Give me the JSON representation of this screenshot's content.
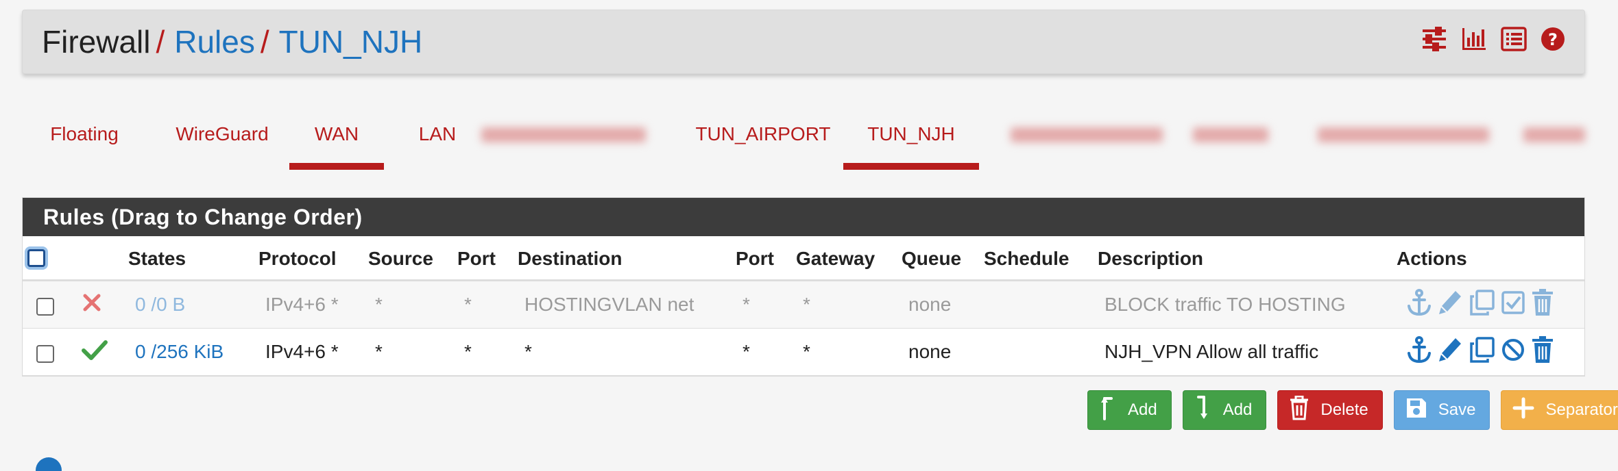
{
  "breadcrumb": {
    "home": "Firewall",
    "sep": "/",
    "rules": "Rules",
    "current": "TUN_NJH"
  },
  "header_icons": [
    "sliders-icon",
    "bar-chart-icon",
    "list-icon",
    "help-icon"
  ],
  "tabs": [
    {
      "label": "Floating",
      "active": false
    },
    {
      "label": "WireGuard",
      "active": false
    },
    {
      "label": "WAN",
      "active": true
    },
    {
      "label": "LAN",
      "active": false
    },
    {
      "label": "TUN_AIRPORT",
      "active": false
    },
    {
      "label": "TUN_NJH",
      "active": true
    }
  ],
  "panel": {
    "title": "Rules (Drag to Change Order)",
    "columns": [
      "States",
      "Protocol",
      "Source",
      "Port",
      "Destination",
      "Port",
      "Gateway",
      "Queue",
      "Schedule",
      "Description",
      "Actions"
    ],
    "rows": [
      {
        "enabled": false,
        "status": "block",
        "states": "0 /0 B",
        "protocol": "IPv4+6 *",
        "source": "*",
        "source_port": "*",
        "destination": "HOSTINGVLAN net",
        "dest_port": "*",
        "gateway": "*",
        "queue": "none",
        "schedule": "",
        "description": "BLOCK traffic TO HOSTING"
      },
      {
        "enabled": true,
        "status": "pass",
        "states": "0 /256 KiB",
        "protocol": "IPv4+6 *",
        "source": "*",
        "source_port": "*",
        "destination": "*",
        "dest_port": "*",
        "gateway": "*",
        "queue": "none",
        "schedule": "",
        "description": "NJH_VPN Allow all traffic"
      }
    ]
  },
  "buttons": {
    "add_top": "Add",
    "add_bottom": "Add",
    "delete": "Delete",
    "save": "Save",
    "separator": "Separator"
  },
  "colors": {
    "brand_red": "#b71c1c",
    "link_blue": "#1e73be",
    "green": "#43a047",
    "orange": "#f2b04a"
  }
}
